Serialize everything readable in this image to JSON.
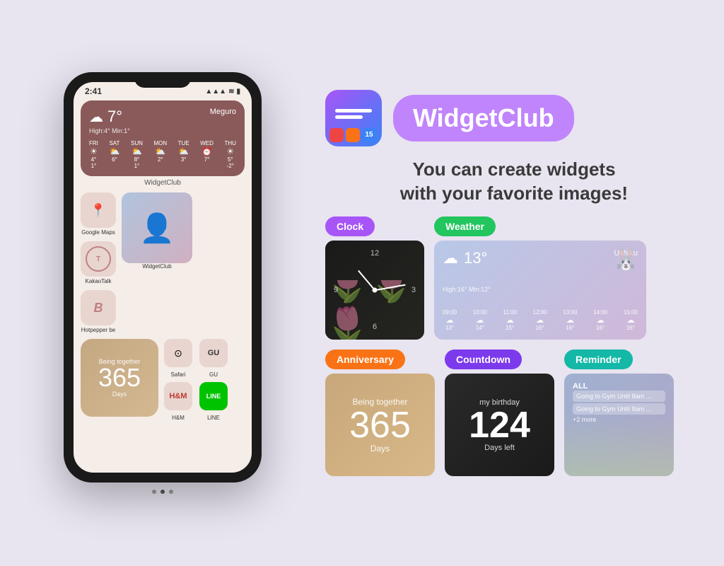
{
  "app": {
    "name": "WidgetClub",
    "tagline_line1": "You can create widgets",
    "tagline_line2": "with your favorite images!"
  },
  "phone": {
    "status_time": "2:41",
    "status_signal": "▲▲▲",
    "status_wifi": "wifi",
    "status_battery": "🔋",
    "weather": {
      "temp": "7°",
      "location": "Meguro",
      "high_low": "High:4° Min:1°",
      "days": [
        {
          "day": "FRI",
          "icon": "☀",
          "high": "4°",
          "low": "1°"
        },
        {
          "day": "SAT",
          "icon": "⛅",
          "high": "6°",
          "low": ""
        },
        {
          "day": "SUN",
          "icon": "⛅",
          "high": "8°",
          "low": "1°"
        },
        {
          "day": "MON",
          "icon": "⛅",
          "high": "2°",
          "low": ""
        },
        {
          "day": "TUE",
          "icon": "⛅",
          "high": "3°",
          "low": ""
        },
        {
          "day": "WED",
          "icon": "⏰",
          "high": "7°",
          "low": ""
        },
        {
          "day": "THU",
          "icon": "☀",
          "high": "5°",
          "low": "-2°"
        }
      ]
    },
    "widget_label": "WidgetClub",
    "apps_row1": [
      {
        "name": "Google Maps",
        "icon": "📍"
      },
      {
        "name": "KakaoTalk",
        "icon": "T"
      },
      {
        "name": "Hotpepper be",
        "icon": "B"
      }
    ],
    "widget_club_label": "WidgetClub",
    "anniversary": {
      "label": "Being together",
      "days": "365",
      "unit": "Days"
    },
    "small_apps": [
      {
        "name": "Safari",
        "icon": "◎"
      },
      {
        "name": "H&M",
        "icon": "H&M"
      },
      {
        "name": "GU",
        "icon": "GU"
      },
      {
        "name": "LINE",
        "icon": "LINE"
      }
    ],
    "pagination_dots": 3,
    "active_dot": 1
  },
  "badges": {
    "clock": "Clock",
    "weather": "Weather",
    "anniversary": "Anniversary",
    "countdown": "Countdown",
    "reminder": "Reminder"
  },
  "clock_widget": {
    "num_12": "12",
    "num_3": "3",
    "num_6": "6",
    "num_9": "9"
  },
  "weather_widget": {
    "temp": "13°",
    "location": "Ushiku",
    "high_low": "High:16° Min:12°",
    "times": [
      "09:00",
      "10:00",
      "11:00",
      "12:00",
      "13:00",
      "14:00",
      "15:00"
    ],
    "temps": [
      "13°",
      "14°",
      "15°",
      "16°",
      "16°",
      "16°",
      "16°"
    ]
  },
  "anniversary_widget": {
    "label": "Being together",
    "days": "365",
    "unit": "Days"
  },
  "countdown_widget": {
    "label": "my birthday",
    "number": "124",
    "sublabel": "Days left"
  },
  "reminder_widget": {
    "title": "ALL",
    "item1": "Going to Gym Until 8am ...",
    "item2": "Going to Gym Until 8am ...",
    "more": "+2 more"
  }
}
